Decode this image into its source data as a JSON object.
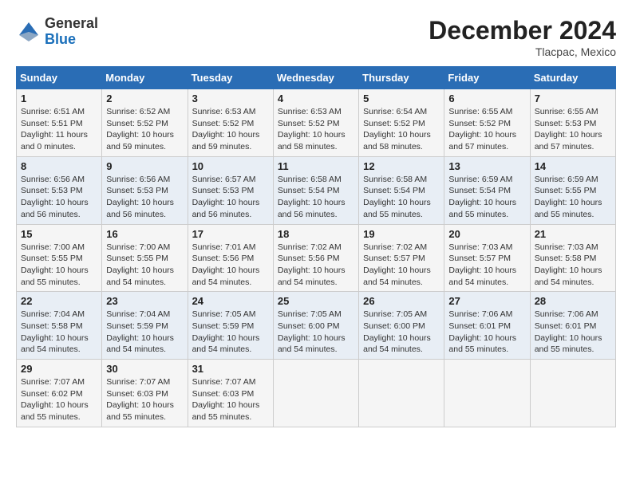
{
  "header": {
    "logo_line1": "General",
    "logo_line2": "Blue",
    "month": "December 2024",
    "location": "Tlacpac, Mexico"
  },
  "days_of_week": [
    "Sunday",
    "Monday",
    "Tuesday",
    "Wednesday",
    "Thursday",
    "Friday",
    "Saturday"
  ],
  "weeks": [
    [
      {
        "day": "1",
        "sunrise": "Sunrise: 6:51 AM",
        "sunset": "Sunset: 5:51 PM",
        "daylight": "Daylight: 11 hours and 0 minutes."
      },
      {
        "day": "2",
        "sunrise": "Sunrise: 6:52 AM",
        "sunset": "Sunset: 5:52 PM",
        "daylight": "Daylight: 10 hours and 59 minutes."
      },
      {
        "day": "3",
        "sunrise": "Sunrise: 6:53 AM",
        "sunset": "Sunset: 5:52 PM",
        "daylight": "Daylight: 10 hours and 59 minutes."
      },
      {
        "day": "4",
        "sunrise": "Sunrise: 6:53 AM",
        "sunset": "Sunset: 5:52 PM",
        "daylight": "Daylight: 10 hours and 58 minutes."
      },
      {
        "day": "5",
        "sunrise": "Sunrise: 6:54 AM",
        "sunset": "Sunset: 5:52 PM",
        "daylight": "Daylight: 10 hours and 58 minutes."
      },
      {
        "day": "6",
        "sunrise": "Sunrise: 6:55 AM",
        "sunset": "Sunset: 5:52 PM",
        "daylight": "Daylight: 10 hours and 57 minutes."
      },
      {
        "day": "7",
        "sunrise": "Sunrise: 6:55 AM",
        "sunset": "Sunset: 5:53 PM",
        "daylight": "Daylight: 10 hours and 57 minutes."
      }
    ],
    [
      {
        "day": "8",
        "sunrise": "Sunrise: 6:56 AM",
        "sunset": "Sunset: 5:53 PM",
        "daylight": "Daylight: 10 hours and 56 minutes."
      },
      {
        "day": "9",
        "sunrise": "Sunrise: 6:56 AM",
        "sunset": "Sunset: 5:53 PM",
        "daylight": "Daylight: 10 hours and 56 minutes."
      },
      {
        "day": "10",
        "sunrise": "Sunrise: 6:57 AM",
        "sunset": "Sunset: 5:53 PM",
        "daylight": "Daylight: 10 hours and 56 minutes."
      },
      {
        "day": "11",
        "sunrise": "Sunrise: 6:58 AM",
        "sunset": "Sunset: 5:54 PM",
        "daylight": "Daylight: 10 hours and 56 minutes."
      },
      {
        "day": "12",
        "sunrise": "Sunrise: 6:58 AM",
        "sunset": "Sunset: 5:54 PM",
        "daylight": "Daylight: 10 hours and 55 minutes."
      },
      {
        "day": "13",
        "sunrise": "Sunrise: 6:59 AM",
        "sunset": "Sunset: 5:54 PM",
        "daylight": "Daylight: 10 hours and 55 minutes."
      },
      {
        "day": "14",
        "sunrise": "Sunrise: 6:59 AM",
        "sunset": "Sunset: 5:55 PM",
        "daylight": "Daylight: 10 hours and 55 minutes."
      }
    ],
    [
      {
        "day": "15",
        "sunrise": "Sunrise: 7:00 AM",
        "sunset": "Sunset: 5:55 PM",
        "daylight": "Daylight: 10 hours and 55 minutes."
      },
      {
        "day": "16",
        "sunrise": "Sunrise: 7:00 AM",
        "sunset": "Sunset: 5:55 PM",
        "daylight": "Daylight: 10 hours and 54 minutes."
      },
      {
        "day": "17",
        "sunrise": "Sunrise: 7:01 AM",
        "sunset": "Sunset: 5:56 PM",
        "daylight": "Daylight: 10 hours and 54 minutes."
      },
      {
        "day": "18",
        "sunrise": "Sunrise: 7:02 AM",
        "sunset": "Sunset: 5:56 PM",
        "daylight": "Daylight: 10 hours and 54 minutes."
      },
      {
        "day": "19",
        "sunrise": "Sunrise: 7:02 AM",
        "sunset": "Sunset: 5:57 PM",
        "daylight": "Daylight: 10 hours and 54 minutes."
      },
      {
        "day": "20",
        "sunrise": "Sunrise: 7:03 AM",
        "sunset": "Sunset: 5:57 PM",
        "daylight": "Daylight: 10 hours and 54 minutes."
      },
      {
        "day": "21",
        "sunrise": "Sunrise: 7:03 AM",
        "sunset": "Sunset: 5:58 PM",
        "daylight": "Daylight: 10 hours and 54 minutes."
      }
    ],
    [
      {
        "day": "22",
        "sunrise": "Sunrise: 7:04 AM",
        "sunset": "Sunset: 5:58 PM",
        "daylight": "Daylight: 10 hours and 54 minutes."
      },
      {
        "day": "23",
        "sunrise": "Sunrise: 7:04 AM",
        "sunset": "Sunset: 5:59 PM",
        "daylight": "Daylight: 10 hours and 54 minutes."
      },
      {
        "day": "24",
        "sunrise": "Sunrise: 7:05 AM",
        "sunset": "Sunset: 5:59 PM",
        "daylight": "Daylight: 10 hours and 54 minutes."
      },
      {
        "day": "25",
        "sunrise": "Sunrise: 7:05 AM",
        "sunset": "Sunset: 6:00 PM",
        "daylight": "Daylight: 10 hours and 54 minutes."
      },
      {
        "day": "26",
        "sunrise": "Sunrise: 7:05 AM",
        "sunset": "Sunset: 6:00 PM",
        "daylight": "Daylight: 10 hours and 54 minutes."
      },
      {
        "day": "27",
        "sunrise": "Sunrise: 7:06 AM",
        "sunset": "Sunset: 6:01 PM",
        "daylight": "Daylight: 10 hours and 55 minutes."
      },
      {
        "day": "28",
        "sunrise": "Sunrise: 7:06 AM",
        "sunset": "Sunset: 6:01 PM",
        "daylight": "Daylight: 10 hours and 55 minutes."
      }
    ],
    [
      {
        "day": "29",
        "sunrise": "Sunrise: 7:07 AM",
        "sunset": "Sunset: 6:02 PM",
        "daylight": "Daylight: 10 hours and 55 minutes."
      },
      {
        "day": "30",
        "sunrise": "Sunrise: 7:07 AM",
        "sunset": "Sunset: 6:03 PM",
        "daylight": "Daylight: 10 hours and 55 minutes."
      },
      {
        "day": "31",
        "sunrise": "Sunrise: 7:07 AM",
        "sunset": "Sunset: 6:03 PM",
        "daylight": "Daylight: 10 hours and 55 minutes."
      },
      null,
      null,
      null,
      null
    ]
  ]
}
